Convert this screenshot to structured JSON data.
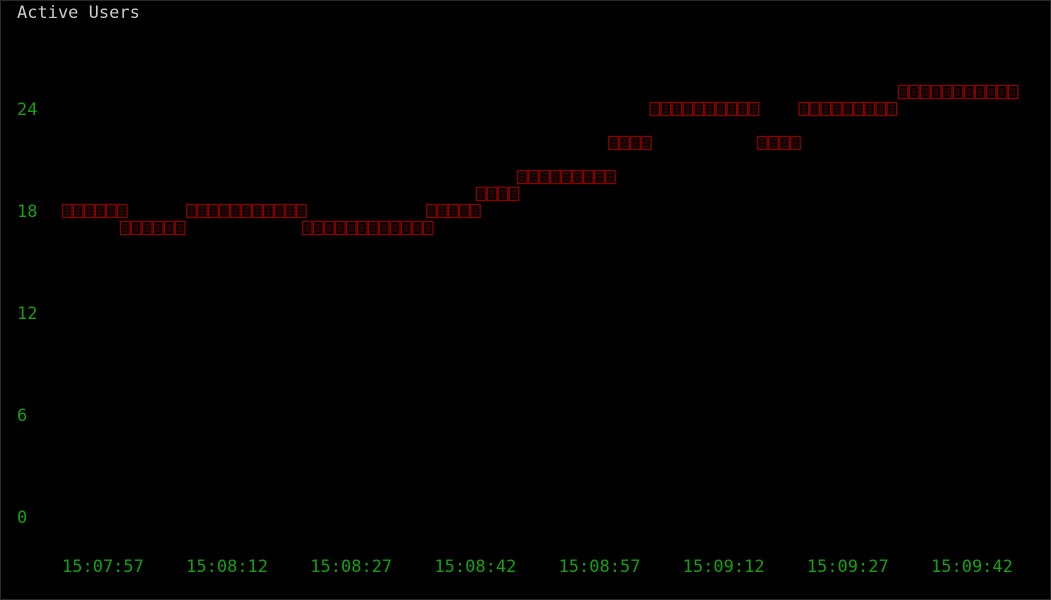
{
  "window": {
    "title": "Active Users"
  },
  "colors": {
    "background": "#000000",
    "title": "#cccccc",
    "axis_labels": "#13a10e",
    "series": "#8b0000"
  },
  "chart_data": {
    "type": "line",
    "title": "Active Users",
    "xlabel": "",
    "ylabel": "",
    "ylim": [
      0,
      26
    ],
    "yticks": [
      0,
      6,
      12,
      18,
      24
    ],
    "grid": false,
    "legend": "none",
    "x_tick_labels": [
      "15:07:57",
      "15:08:12",
      "15:08:27",
      "15:08:42",
      "15:08:57",
      "15:09:12",
      "15:09:27",
      "15:09:42"
    ],
    "x_range_seconds": [
      "15:07:57",
      "15:09:42"
    ],
    "series": [
      {
        "segments": [
          {
            "start": "15:07:57",
            "end": "15:08:03",
            "value": 18
          },
          {
            "start": "15:08:04",
            "end": "15:08:11",
            "value": 17
          },
          {
            "start": "15:08:12",
            "end": "15:08:25",
            "value": 18
          },
          {
            "start": "15:08:26",
            "end": "15:08:40",
            "value": 17
          },
          {
            "start": "15:08:41",
            "end": "15:08:46",
            "value": 18
          },
          {
            "start": "15:08:47",
            "end": "15:08:51",
            "value": 19
          },
          {
            "start": "15:08:52",
            "end": "15:09:02",
            "value": 20
          },
          {
            "start": "15:09:03",
            "end": "15:09:07",
            "value": 22
          },
          {
            "start": "15:09:08",
            "end": "15:09:20",
            "value": 24
          },
          {
            "start": "15:09:21",
            "end": "15:09:25",
            "value": 22
          },
          {
            "start": "15:09:26",
            "end": "15:09:37",
            "value": 24
          },
          {
            "start": "15:09:38",
            "end": "15:10:02",
            "value": 25
          }
        ]
      }
    ]
  }
}
